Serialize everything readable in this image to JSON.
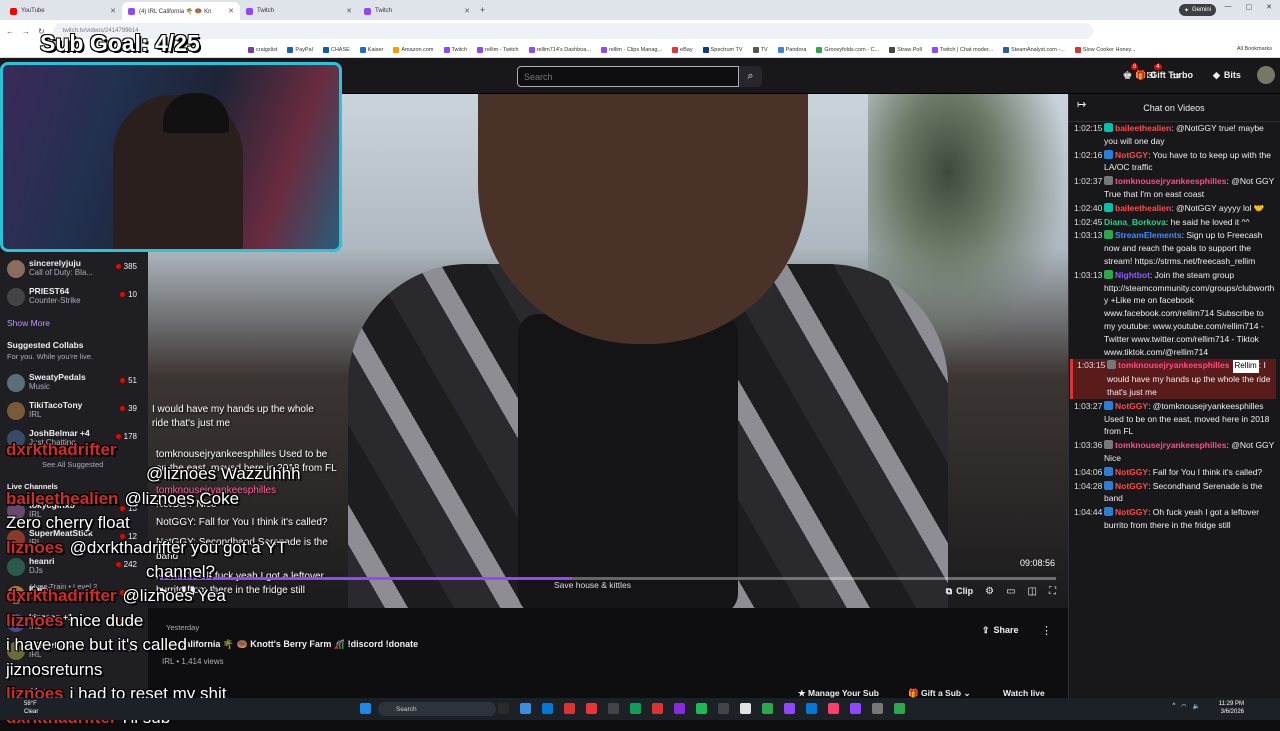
{
  "browser": {
    "tabs": [
      {
        "label": "YouTube",
        "active": false,
        "favicon_color": "#ff0000"
      },
      {
        "label": "(4) IRL California 🌴 🍩 Kn",
        "active": true,
        "favicon_color": "#9147ff"
      },
      {
        "label": "Twitch",
        "active": false,
        "favicon_color": "#9147ff"
      },
      {
        "label": "Twitch",
        "active": false,
        "favicon_color": "#9147ff"
      }
    ],
    "new_tab": "+",
    "gemini_label": "Gemini",
    "url": "twitch.tv/videos/2414799614",
    "bookmarks": [
      "craigslist",
      "PayPal",
      "CHASE",
      "Kaiser",
      "Amazon.com",
      "Twitch",
      "rellim - Twitch",
      "rellim714's Dashboa...",
      "rellim - Clips Manag...",
      "eBay",
      "Spectrum TV",
      "TV",
      "Pandora",
      "Groovyfolds.com - C...",
      "Straw Poll",
      "Twitch | Chat moder...",
      "SteamAnalyst.com -...",
      "Slow Cooker Honey..."
    ],
    "all_bookmarks": "All Bookmarks"
  },
  "twitch_nav": {
    "search_placeholder": "Search",
    "notif_badge_1": "8",
    "notif_badge_2": "4",
    "gift_turbo": "Gift Turbo",
    "bits": "Bits"
  },
  "overlay": {
    "sub_goal": "Sub Goal: 4/25"
  },
  "sidebar": {
    "channels": [
      {
        "name": "sincerelyjuju",
        "game": "Call of Duty: Bla...",
        "viewers": "385",
        "avatar_color": "#8a6b5c"
      },
      {
        "name": "PRIEST64",
        "game": "Counter-Strike",
        "viewers": "10",
        "avatar_color": "#444"
      }
    ],
    "show_more": "Show More",
    "suggested_title": "Suggested Collabs",
    "suggested_sub": "For you. While you're live.",
    "suggested": [
      {
        "name": "SweatyPedals",
        "game": "Music",
        "viewers": "51",
        "avatar_color": "#5a6e7a"
      },
      {
        "name": "TikiTacoTony",
        "game": "IRL",
        "viewers": "39",
        "avatar_color": "#7a5a3a"
      },
      {
        "name": "JoshBelmar +4",
        "game": "Just Chatting",
        "viewers": "178",
        "avatar_color": "#3a4a6a"
      }
    ],
    "see_all": "See All Suggested",
    "live_channels": "Live Channels",
    "live": [
      {
        "name": "tokyogirixo",
        "game": "IRL",
        "viewers": "13",
        "avatar_color": "#6a4a6a"
      },
      {
        "name": "SuperMeatStick",
        "game": "IRL",
        "viewers": "12",
        "avatar_color": "#8a3a2a"
      },
      {
        "name": "heanri",
        "game": "DJs",
        "viewers": "242",
        "avatar_color": "#2a5a4a"
      },
      {
        "name": "Kaise",
        "game": "PICO PARK 2",
        "viewers": "12",
        "avatar_color": "#aa7a2a"
      },
      {
        "name": "kinzson +1",
        "game": "IRL",
        "viewers": "42",
        "avatar_color": "#4a4a8a"
      },
      {
        "name": "misterbanhmi",
        "game": "IRL",
        "viewers": "12",
        "avatar_color": "#6a6a3a"
      }
    ],
    "hype_train": "Hype Train • Level 2",
    "show_more_2": "Show More"
  },
  "video": {
    "chat_overlay_lines": [
      {
        "text": "I would have my hands up the whole",
        "color": "#ffffff"
      },
      {
        "text": "ride that's just me",
        "color": "#ffffff"
      },
      {
        "text": "tomknousejryankeesphilles Used to be",
        "color": "#ffffff"
      },
      {
        "text": "on the east, moved here in 2018 from FL",
        "color": "#ffffff"
      },
      {
        "text": "tomknousejryankeesphilles",
        "color": "#ff5fa0"
      },
      {
        "text": "NotGGY Nice",
        "color": "#ffffff"
      },
      {
        "text": "NotGGY: Fall for You I think it's called?",
        "color": "#ffffff"
      },
      {
        "text": "NotGGY: Secondhand Serenade is the",
        "color": "#ffffff"
      },
      {
        "text": "band",
        "color": "#ffffff"
      },
      {
        "text": "NotGGY: Oh fuck yeah I got a leftover",
        "color": "#ffffff"
      },
      {
        "text": "burrito from there in the fridge still",
        "color": "#ffffff"
      }
    ],
    "time": "09:08:56",
    "progress": 0.46,
    "caption": "Save house & kittles",
    "clip_label": "Clip"
  },
  "below_video": {
    "date": "Yesterday",
    "title": "IRL California 🌴 🍩 Knott's Berry Farm 🎢 !discord !donate",
    "views": "IRL • 1,414 views",
    "share": "Share",
    "manage_sub": "Manage Your Sub",
    "gift_a_sub": "Gift a Sub",
    "watch_live": "Watch live"
  },
  "stream_chat_overlay": [
    {
      "user": "dxrkthadrifter",
      "user_color": "#d32a2a",
      "text": ""
    },
    {
      "user": "",
      "user_color": "#ffffff",
      "text": "@liznoes Wazzuhhh"
    },
    {
      "user": "baileethealien",
      "user_color": "#d32a2a",
      "text": "@liznoes Coke"
    },
    {
      "user": "",
      "user_color": "#ffffff",
      "text": "Zero cherry float"
    },
    {
      "user": "liznoes",
      "user_color": "#d32a2a",
      "text": "@dxrkthadrifter you got a YT"
    },
    {
      "user": "",
      "user_color": "#ffffff",
      "text": "channel?"
    },
    {
      "user": "dxrkthadrifter",
      "user_color": "#d32a2a",
      "text": "@liznoes Yea"
    },
    {
      "user": "liznoes",
      "user_color": "#d32a2a",
      "text": "nice dude"
    },
    {
      "user": "",
      "user_color": "#ffffff",
      "text": "i have one but it's called"
    },
    {
      "user": "",
      "user_color": "#ffffff",
      "text": "jiznosreturns"
    },
    {
      "user": "liznoes",
      "user_color": "#d32a2a",
      "text": "i had to reset my shit"
    },
    {
      "user": "dxrkthadrifter",
      "user_color": "#d32a2a",
      "text": "I'll sub"
    }
  ],
  "chat": {
    "header": "Chat on Videos",
    "messages": [
      {
        "ts": "1:02:15",
        "badge_color": "#00c2a8",
        "user": "baileethealien",
        "user_color": "#ff4a4a",
        "text": ": @NotGGY true! maybe you will one day",
        "highlight": false
      },
      {
        "ts": "1:02:16",
        "badge_color": "#2a7fd4",
        "user": "NotGGY",
        "user_color": "#ff4a4a",
        "text": ": You have to to keep up with the LA/OC traffic",
        "highlight": false
      },
      {
        "ts": "1:02:37",
        "badge_color": "#777777",
        "user": "tomknousejryankeesphilles",
        "user_color": "#ff4a88",
        "text": ": @Not GGY True that I'm on east coast",
        "highlight": false
      },
      {
        "ts": "1:02:40",
        "badge_color": "#00c2a8",
        "user": "baileethealien",
        "user_color": "#ff4a4a",
        "text": ": @NotGGY ayyyy lol 🤝",
        "highlight": false
      },
      {
        "ts": "1:02:45",
        "badge_color": "",
        "user": "Diana_Borkova",
        "user_color": "#1fd48a",
        "text": ": he said he loved it ^^",
        "highlight": false
      },
      {
        "ts": "1:03:13",
        "badge_color": "#2aa84a",
        "user": "StreamElements",
        "user_color": "#3a8fff",
        "text": ": Sign up to Freecash now and reach the goals to support the stream! https://strms.net/freecash_rellim",
        "highlight": false
      },
      {
        "ts": "1:03:13",
        "badge_color": "#2aa84a",
        "user": "Nightbot",
        "user_color": "#8a5cff",
        "text": ": Join the steam group http://steamcommunity.com/groups/clubworthy +Like me on facebook www.facebook.com/rellim714 Subscribe to my youtube: www.youtube.com/rellim714 - Twitter www.twitter.com/rellim714 - Tiktok www.tiktok.com/@rellim714",
        "highlight": false
      },
      {
        "ts": "1:03:15",
        "badge_color": "#777777",
        "user": "tomknousejryankeesphilles",
        "user_color": "#ff4a88",
        "text": ": I would have my hands up the whole the ride that's just me",
        "highlight": true,
        "mention": "Rellim"
      },
      {
        "ts": "1:03:27",
        "badge_color": "#2a7fd4",
        "user": "NotGGY",
        "user_color": "#ff4a4a",
        "text": ": @tomknousejryankeesphilles Used to be on the east, moved here in 2018 from FL",
        "highlight": false
      },
      {
        "ts": "1:03:36",
        "badge_color": "#777777",
        "user": "tomknousejryankeesphilles",
        "user_color": "#ff4a88",
        "text": ": @Not GGY Nice",
        "highlight": false
      },
      {
        "ts": "1:04:06",
        "badge_color": "#2a7fd4",
        "user": "NotGGY",
        "user_color": "#ff4a4a",
        "text": ": Fall for You I think it's called?",
        "highlight": false
      },
      {
        "ts": "1:04:28",
        "badge_color": "#2a7fd4",
        "user": "NotGGY",
        "user_color": "#ff4a4a",
        "text": ": Secondhand Serenade is the band",
        "highlight": false
      },
      {
        "ts": "1:04:44",
        "badge_color": "#2a7fd4",
        "user": "NotGGY",
        "user_color": "#ff4a4a",
        "text": ": Oh fuck yeah I got a leftover burrito from there in the fridge still",
        "highlight": false
      }
    ]
  },
  "taskbar": {
    "weather_temp": "58°F",
    "weather_desc": "Clear",
    "search": "Search",
    "time": "11:29 PM",
    "date": "3/6/2026",
    "app_colors": [
      "#1e88e5",
      "#2b2b2b",
      "#3c8dde",
      "#0078d4",
      "#d33",
      "#e33",
      "#444",
      "#0f9d58",
      "#d33",
      "#8a2be2",
      "#1db954",
      "#444",
      "#e2e2e2",
      "#2aa84a",
      "#9147ff",
      "#0078d4",
      "#ff3d6e",
      "#9147ff",
      "#777",
      "#2aa84a"
    ]
  }
}
